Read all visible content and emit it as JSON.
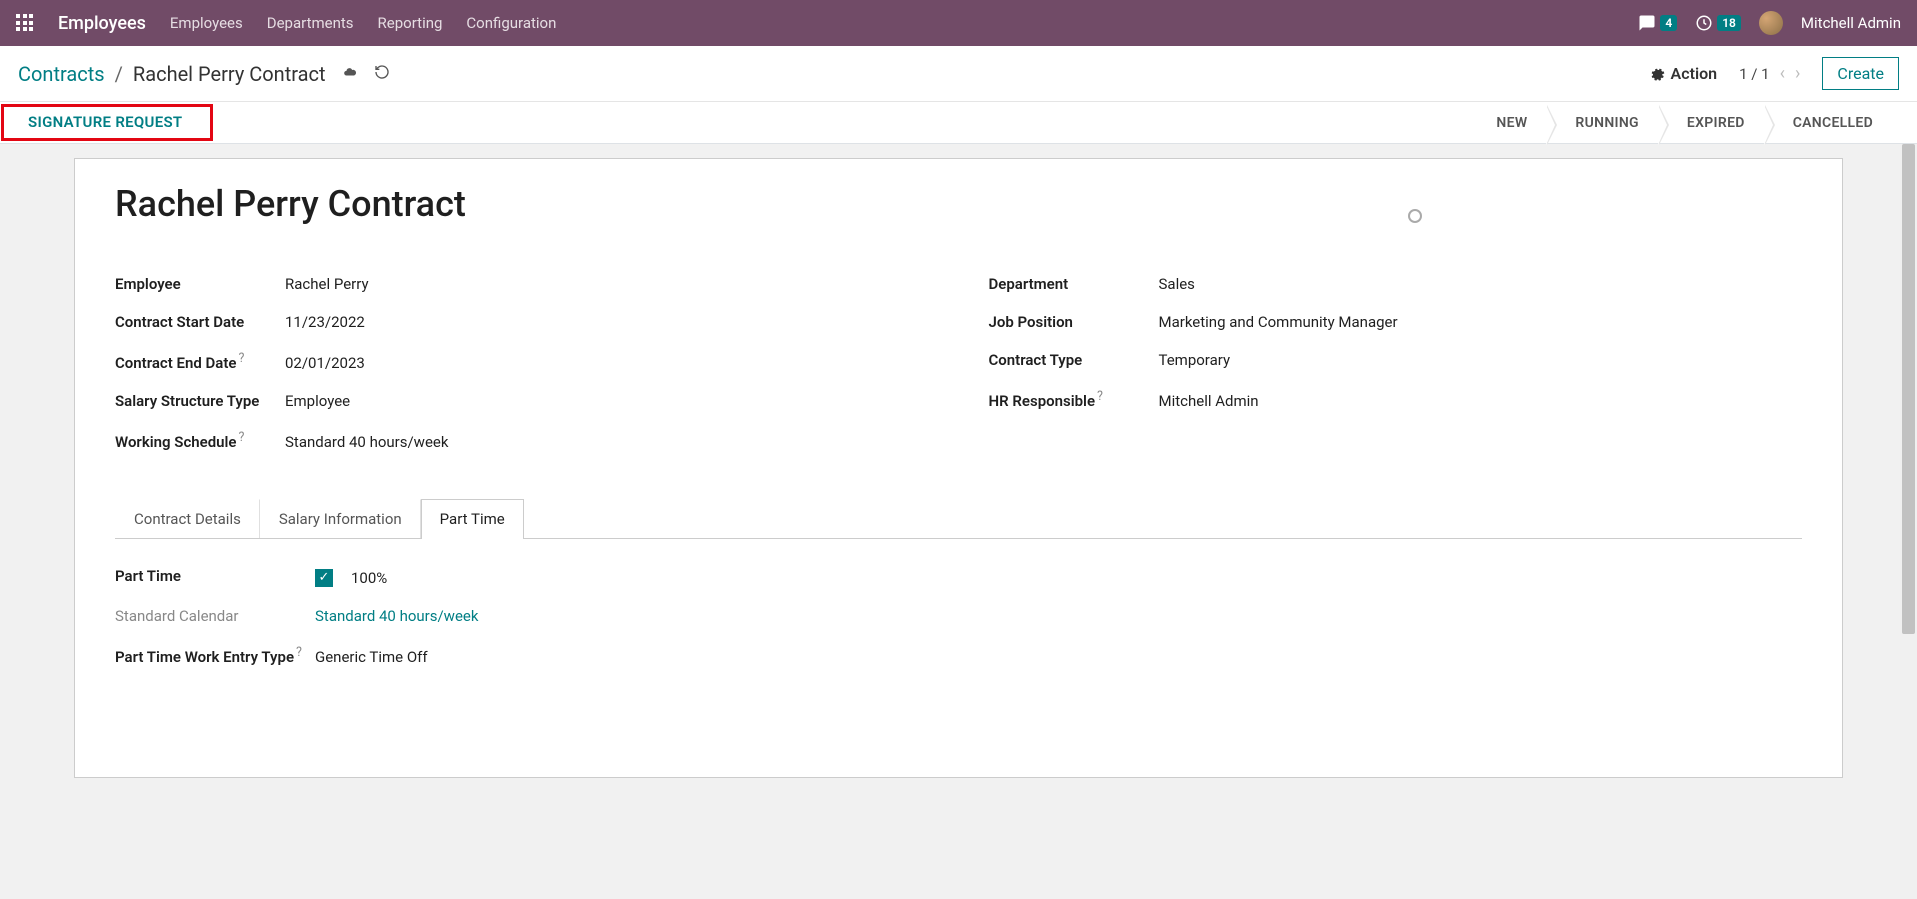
{
  "navbar": {
    "app_name": "Employees",
    "links": [
      "Employees",
      "Departments",
      "Reporting",
      "Configuration"
    ],
    "messages_badge": "4",
    "activities_badge": "18",
    "user_name": "Mitchell Admin"
  },
  "breadcrumb": {
    "parent": "Contracts",
    "sep": "/",
    "current": "Rachel Perry Contract"
  },
  "controls": {
    "action_label": "Action",
    "pager": "1 / 1",
    "create_label": "Create"
  },
  "signature_request": "SIGNATURE REQUEST",
  "statusbar": [
    "NEW",
    "RUNNING",
    "EXPIRED",
    "CANCELLED"
  ],
  "form": {
    "title": "Rachel Perry Contract",
    "left": {
      "employee_label": "Employee",
      "employee_value": "Rachel Perry",
      "start_label": "Contract Start Date",
      "start_value": "11/23/2022",
      "end_label": "Contract End Date",
      "end_value": "02/01/2023",
      "salary_struct_label": "Salary Structure Type",
      "salary_struct_value": "Employee",
      "schedule_label": "Working Schedule",
      "schedule_value": "Standard 40 hours/week"
    },
    "right": {
      "department_label": "Department",
      "department_value": "Sales",
      "position_label": "Job Position",
      "position_value": "Marketing and Community Manager",
      "type_label": "Contract Type",
      "type_value": "Temporary",
      "hr_label": "HR Responsible",
      "hr_value": "Mitchell Admin"
    }
  },
  "tabs": {
    "items": [
      "Contract Details",
      "Salary Information",
      "Part Time"
    ]
  },
  "part_time": {
    "pt_label": "Part Time",
    "pt_percent": "100%",
    "calendar_label": "Standard Calendar",
    "calendar_value": "Standard 40 hours/week",
    "entry_label": "Part Time Work Entry Type",
    "entry_value": "Generic Time Off"
  }
}
